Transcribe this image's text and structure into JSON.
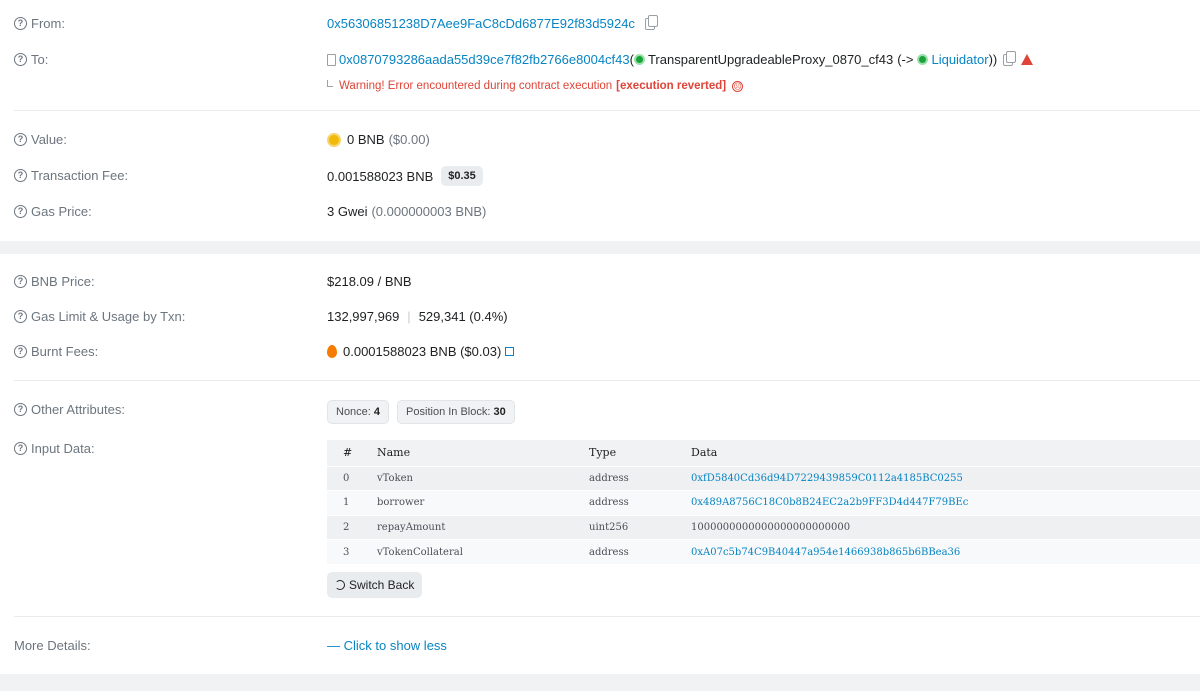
{
  "from": {
    "label": "From:",
    "address": "0x56306851238D7Aee9FaC8cDd6877E92f83d5924c"
  },
  "to": {
    "label": "To:",
    "address": "0x0870793286aada55d39ce7f82fb2766e8004cf43",
    "open_paren": "(",
    "proxy_name": "TransparentUpgradeableProxy_0870_cf43",
    "arrow": "(->",
    "impl_name": "Liquidator",
    "close_paren": "))",
    "warning_prefix": "Warning! Error encountered during contract execution",
    "warning_reason": "[execution reverted]",
    "warning_face": "☹"
  },
  "value": {
    "label": "Value:",
    "amount": "0 BNB",
    "usd": "($0.00)"
  },
  "fee": {
    "label": "Transaction Fee:",
    "amount": "0.001588023 BNB",
    "usd_badge": "$0.35"
  },
  "gas_price": {
    "label": "Gas Price:",
    "gwei": "3 Gwei",
    "bnb": "(0.000000003 BNB)"
  },
  "bnb_price": {
    "label": "BNB Price:",
    "value": "$218.09 / BNB"
  },
  "gas_limit": {
    "label": "Gas Limit & Usage by Txn:",
    "limit": "132,997,969",
    "sep": "|",
    "usage": "529,341 (0.4%)"
  },
  "burnt": {
    "label": "Burnt Fees:",
    "value": "0.0001588023 BNB ($0.03)"
  },
  "other": {
    "label": "Other Attributes:",
    "nonce_label": "Nonce:",
    "nonce": "4",
    "position_label": "Position In Block:",
    "position": "30"
  },
  "input": {
    "label": "Input Data:",
    "headers": [
      "#",
      "Name",
      "Type",
      "Data"
    ],
    "rows": [
      {
        "idx": "0",
        "name": "vToken",
        "type": "address",
        "data": "0xfD5840Cd36d94D7229439859C0112a4185BC0255",
        "link": true
      },
      {
        "idx": "1",
        "name": "borrower",
        "type": "address",
        "data": "0x489A8756C18C0b8B24EC2a2b9FF3D4d447F79BEc",
        "link": true
      },
      {
        "idx": "2",
        "name": "repayAmount",
        "type": "uint256",
        "data": "1000000000000000000000000",
        "link": false
      },
      {
        "idx": "3",
        "name": "vTokenCollateral",
        "type": "address",
        "data": "0xA07c5b74C9B40447a954e1466938b865b6BBea36",
        "link": true
      }
    ],
    "switch_label": "Switch Back"
  },
  "more": {
    "label": "More Details:",
    "link": "— Click to show less"
  },
  "colors": {
    "link": "#0784c3",
    "error": "#de4437",
    "muted": "#6c757e"
  }
}
